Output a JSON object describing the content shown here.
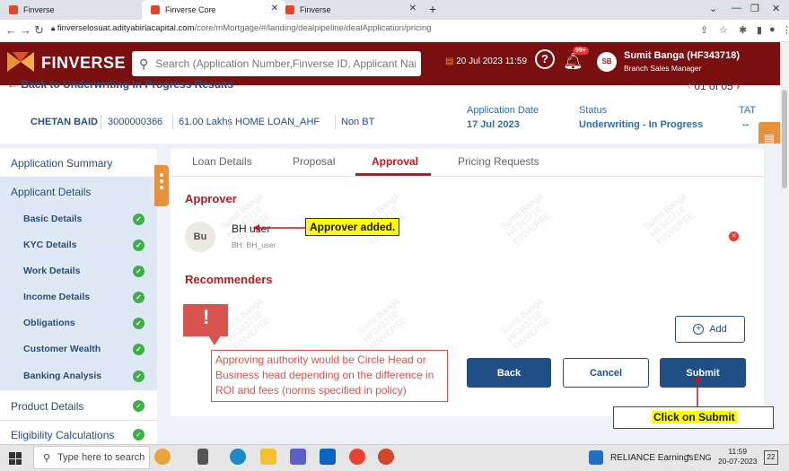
{
  "browser": {
    "tabs": [
      {
        "label": "Finverse"
      },
      {
        "label": "Finverse Core"
      },
      {
        "label": "Finverse"
      }
    ],
    "url_host": "finverselosuat.adityabirlacapital.com",
    "url_path": "/core/mMortgage/#/landing/dealpipeline/dealApplication/pricing"
  },
  "header": {
    "brand": "FINVERSE",
    "search_placeholder": "Search (Application Number,Finverse ID, Applicant Name, PAN)",
    "datetime": "20 Jul 2023 11:59",
    "notif_badge": "99+",
    "avatar_initials": "SB",
    "user_name": "Sumit Banga (HF343718)",
    "user_role": "Branch Sales Manager"
  },
  "back_link": "Back to Underwriting In Progress Results",
  "pager": {
    "text": "01 of 05"
  },
  "application": {
    "name": "CHETAN BAID",
    "number": "3000000366",
    "amount": "61.00 Lakhs",
    "product": "HOME LOAN_AHF",
    "type": "Non BT",
    "date_label": "Application Date",
    "date_value": "17 Jul 2023",
    "status_label": "Status",
    "status_value": "Underwriting - In Progress",
    "tat_label": "TAT",
    "tat_value": "--"
  },
  "sidebar": {
    "application_summary": "Application Summary",
    "applicant_details": "Applicant Details",
    "items": [
      {
        "label": "Basic Details"
      },
      {
        "label": "KYC Details"
      },
      {
        "label": "Work Details"
      },
      {
        "label": "Income Details"
      },
      {
        "label": "Obligations"
      },
      {
        "label": "Customer Wealth"
      },
      {
        "label": "Banking Analysis"
      }
    ],
    "product_details": "Product Details",
    "eligibility": "Eligibility Calculations"
  },
  "tabs": {
    "loan_details": "Loan Details",
    "proposal": "Proposal",
    "approval": "Approval",
    "pricing": "Pricing Requests"
  },
  "approval": {
    "approver_heading": "Approver",
    "approver_initials": "Bu",
    "approver_name": "BH user",
    "approver_sub": "BH: BH_user",
    "recommenders_heading": "Recommenders",
    "add_label": "Add",
    "back_label": "Back",
    "cancel_label": "Cancel",
    "submit_label": "Submit"
  },
  "annotations": {
    "approver_added": "Approver added.",
    "note": "Approving authority would be Circle Head or Business head depending on the difference in ROI and fees (norms specified in policy)",
    "click_submit": "Click on Submit"
  },
  "watermark": {
    "line1": "Sumit Banga",
    "line2": "HF343718",
    "line3": "FINVERSE"
  },
  "taskbar": {
    "search_placeholder": "Type here to search",
    "news": "RELIANCE  Earnings",
    "lang": "ENG",
    "time": "11:59",
    "date": "20-07-2023",
    "notif_count": "22"
  }
}
